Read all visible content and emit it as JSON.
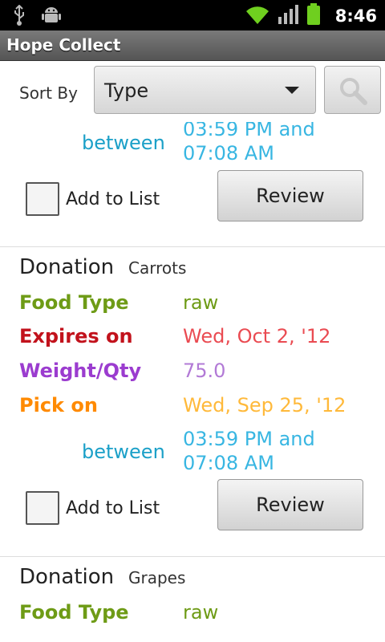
{
  "status_bar": {
    "time": "8:46",
    "icons": [
      "usb-icon",
      "android-debug-icon",
      "wifi-icon",
      "signal-icon",
      "battery-icon"
    ]
  },
  "app": {
    "title": "Hope Collect"
  },
  "sort": {
    "label": "Sort By",
    "selected": "Type",
    "search_icon": "search-icon"
  },
  "partial_item": {
    "between_label": "between",
    "time_range_line1": "03:59 PM and",
    "time_range_line2": "07:08 AM",
    "add_label": "Add to List",
    "review_label": "Review"
  },
  "items": [
    {
      "donation_label": "Donation",
      "name": "Carrots",
      "food_type_label": "Food Type",
      "food_type": "raw",
      "expires_label": "Expires on",
      "expires": "Wed, Oct 2, '12",
      "weight_label": "Weight/Qty",
      "weight": "75.0",
      "pick_label": "Pick on",
      "pick": "Wed, Sep 25, '12",
      "between_label": "between",
      "time_range_line1": "03:59 PM and",
      "time_range_line2": "07:08 AM",
      "add_label": "Add to List",
      "review_label": "Review"
    },
    {
      "donation_label": "Donation",
      "name": "Grapes",
      "food_type_label": "Food Type",
      "food_type": "raw"
    }
  ],
  "colors": {
    "food_type": "#6e9b16",
    "expires_label": "#c2121c",
    "expires_value": "#ea4b52",
    "weight_label": "#9b3ccf",
    "weight_value": "#b27ad6",
    "pick_label": "#ff8a00",
    "pick_value": "#ffb93a",
    "between": "#1ba0c8",
    "time_value": "#38b6e2"
  }
}
